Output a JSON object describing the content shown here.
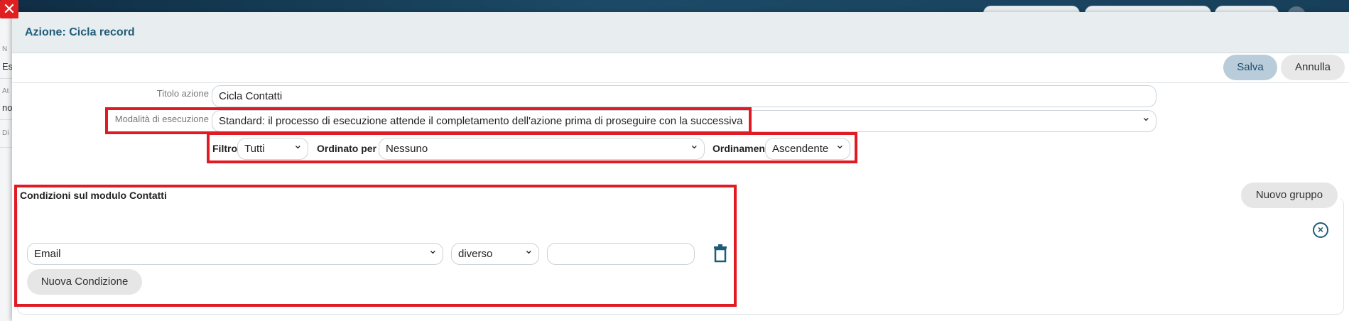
{
  "background": {
    "side_labels": [
      "N",
      "Es",
      "At",
      "no",
      "Di"
    ]
  },
  "modal": {
    "title": "Azione: Cicla record",
    "save_label": "Salva",
    "cancel_label": "Annulla"
  },
  "form": {
    "title_label": "Titolo azione",
    "title_value": "Cicla Contatti",
    "mode_label": "Modalità di esecuzione",
    "mode_value": "Standard: il processo di esecuzione attende il completamento dell'azione prima di proseguire con la successiva",
    "filter_label": "Filtro",
    "filter_value": "Tutti",
    "order_by_label": "Ordinato per",
    "order_by_value": "Nessuno",
    "ordering_label": "Ordinamento",
    "ordering_value": "Ascendente"
  },
  "conditions": {
    "title": "Condizioni sul modulo Contatti",
    "new_group_label": "Nuovo gruppo",
    "field_value": "Email",
    "operator_value": "diverso",
    "value_input": "",
    "new_condition_label": "Nuova Condizione"
  },
  "colors": {
    "accent": "#1f5c7a",
    "highlight": "#e01b24",
    "save_bg": "#b9ccd9"
  }
}
